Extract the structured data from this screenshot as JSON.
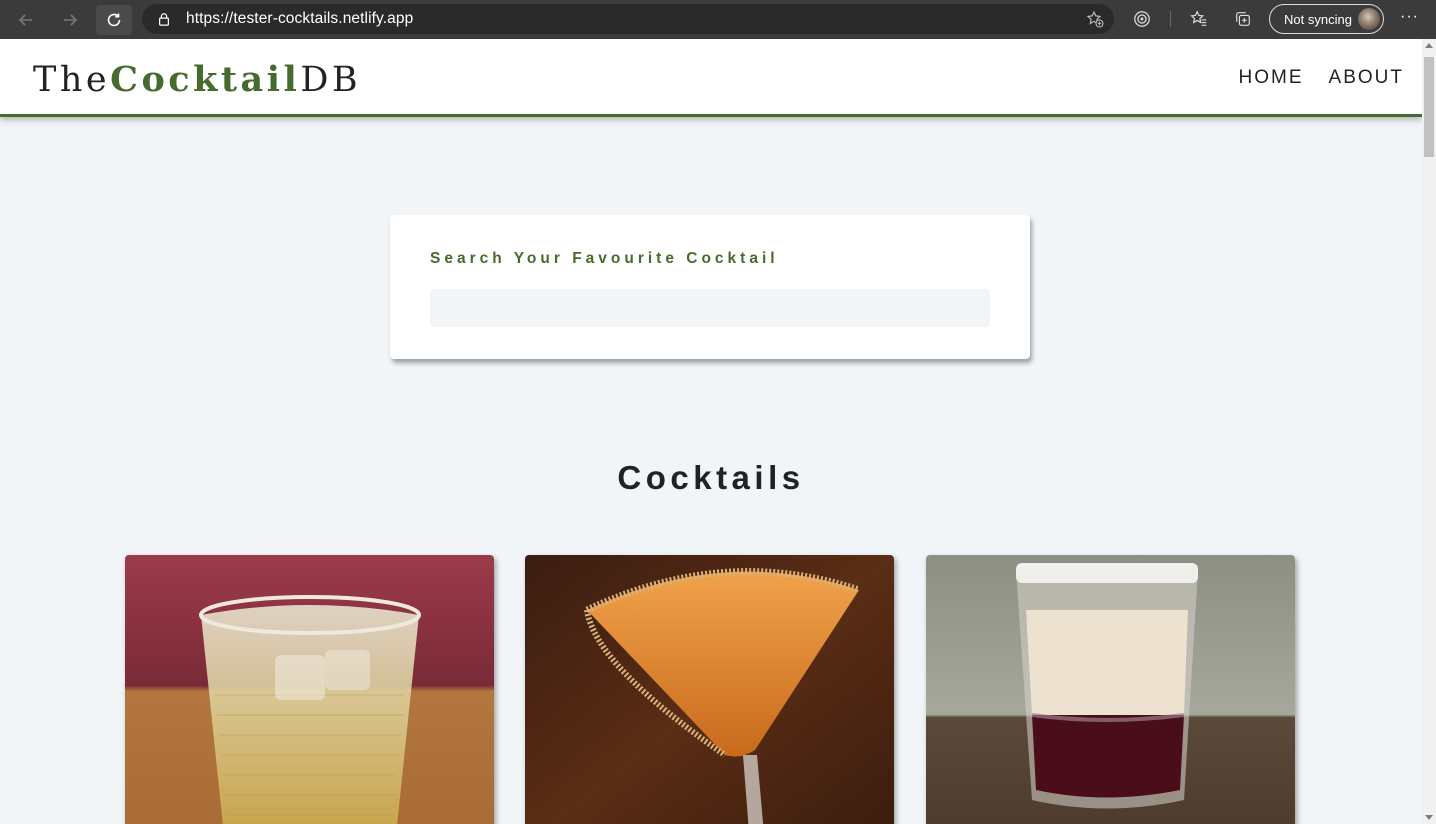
{
  "browser": {
    "url": "https://tester-cocktails.netlify.app",
    "profile_label": "Not syncing",
    "more_label": "···"
  },
  "site": {
    "logo": {
      "prefix": "The",
      "accent": "Cocktail",
      "suffix": "DB"
    },
    "nav": [
      {
        "label": "Home"
      },
      {
        "label": "About"
      }
    ],
    "brand_color": "#476a2e",
    "background_color": "#f1f5f8"
  },
  "search": {
    "label": "Search Your Favourite Cocktail",
    "value": "",
    "placeholder": ""
  },
  "cocktails": {
    "title": "Cocktails",
    "cards": [
      {
        "image": "old-fashioned-glass-drink-image"
      },
      {
        "image": "orange-martini-glass-image"
      },
      {
        "image": "layered-shot-glass-image"
      }
    ]
  }
}
